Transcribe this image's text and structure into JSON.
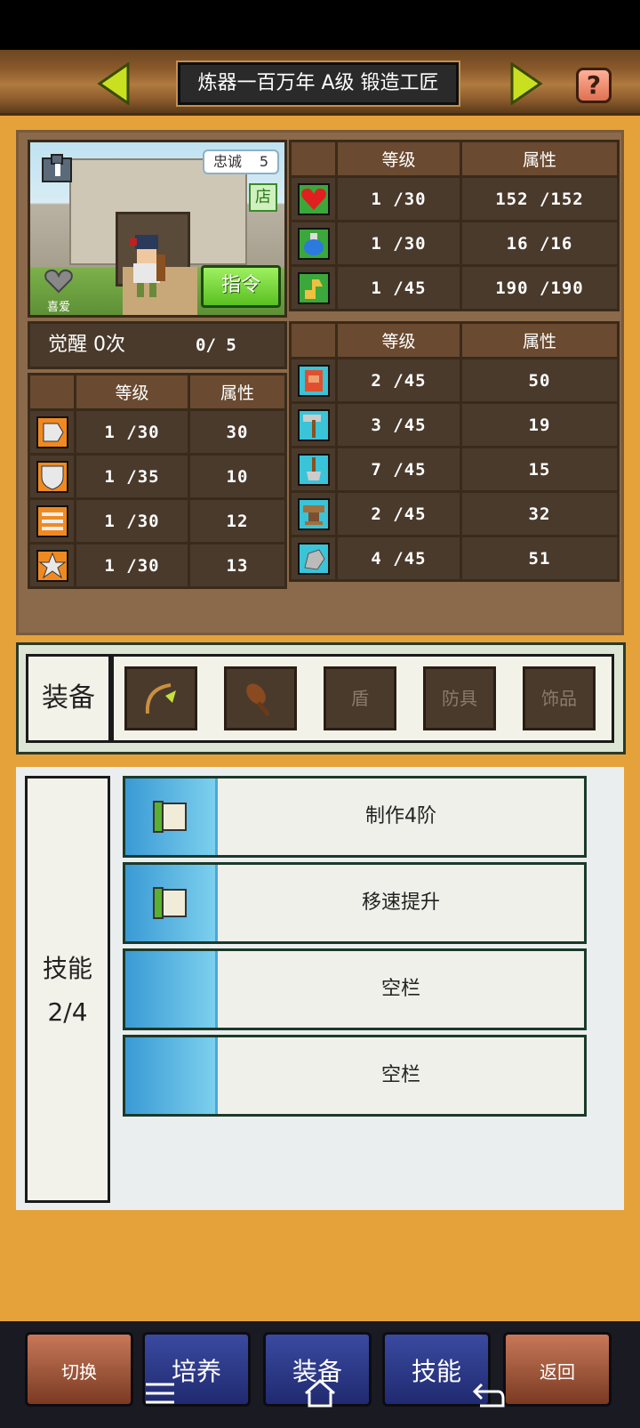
{
  "header": {
    "title": "炼器一百万年 A级 锻造工匠",
    "help_glyph": "?",
    "accent": "#c8e020"
  },
  "portrait": {
    "loyalty_label": "忠诚",
    "loyalty_value": "5",
    "shop_glyph": "店",
    "favorite_label": "喜爱",
    "order_button": "指令"
  },
  "vitals": {
    "headers": [
      "等级",
      "属性"
    ],
    "rows": [
      {
        "icon": "heart-icon",
        "level": "1 /30",
        "value": "152 /152"
      },
      {
        "icon": "potion-icon",
        "level": "1 /30",
        "value": "16 /16"
      },
      {
        "icon": "stamina-icon",
        "level": "1 /45",
        "value": "190 /190"
      }
    ]
  },
  "awaken": {
    "label": "觉醒 0次",
    "count": "0/ 5"
  },
  "combat": {
    "headers": [
      "等级",
      "属性"
    ],
    "rows": [
      {
        "icon": "sword-icon",
        "level": "1 /30",
        "value": "30"
      },
      {
        "icon": "shield-icon",
        "level": "1 /35",
        "value": "10"
      },
      {
        "icon": "bow-icon",
        "level": "1 /30",
        "value": "12"
      },
      {
        "icon": "star-icon",
        "level": "1 /30",
        "value": "13"
      }
    ]
  },
  "crafting": {
    "headers": [
      "等级",
      "属性"
    ],
    "rows": [
      {
        "icon": "book-icon",
        "level": "2 /45",
        "value": "50"
      },
      {
        "icon": "hammer-icon",
        "level": "3 /45",
        "value": "19"
      },
      {
        "icon": "shovel-icon",
        "level": "7 /45",
        "value": "15"
      },
      {
        "icon": "anvil-icon",
        "level": "2 /45",
        "value": "32"
      },
      {
        "icon": "ore-icon",
        "level": "4 /45",
        "value": "51"
      }
    ]
  },
  "equipment": {
    "label": "装备",
    "slots": [
      {
        "icon": "bow-weapon-icon",
        "text": ""
      },
      {
        "icon": "club-icon",
        "text": ""
      },
      {
        "icon": "",
        "text": "盾"
      },
      {
        "icon": "",
        "text": "防具"
      },
      {
        "icon": "",
        "text": "饰品"
      }
    ]
  },
  "skills": {
    "label": "技能",
    "count": "2/4",
    "items": [
      {
        "name": "制作4阶",
        "icon": "scroll-icon"
      },
      {
        "name": "移速提升",
        "icon": "scroll-icon"
      },
      {
        "name": "空栏",
        "icon": ""
      },
      {
        "name": "空栏",
        "icon": ""
      }
    ]
  },
  "bottom_nav": {
    "switch": "切换",
    "train": "培养",
    "equip": "装备",
    "skill": "技能",
    "back": "返回"
  }
}
